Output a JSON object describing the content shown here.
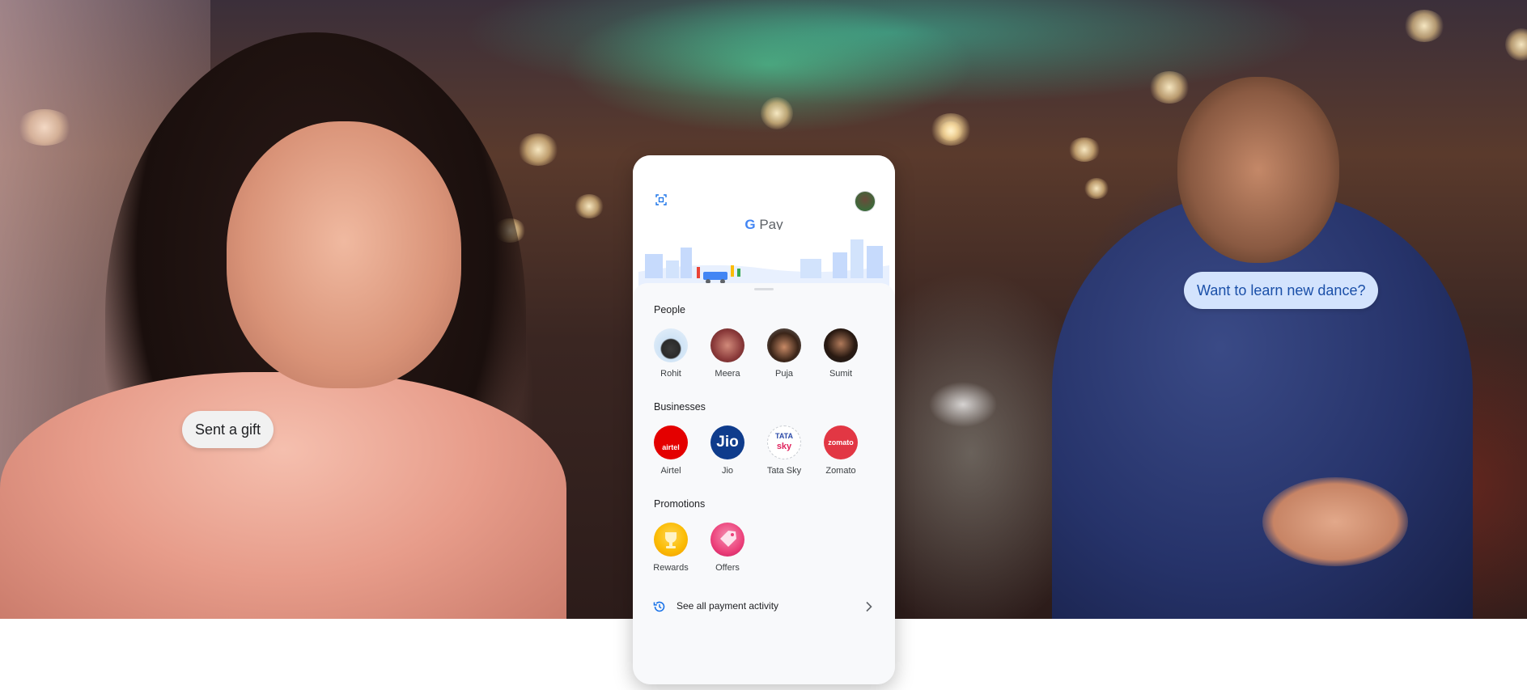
{
  "bubbles": {
    "left": "Sent a gift",
    "right": "Want to learn new dance?"
  },
  "app": {
    "logo_g": "G",
    "logo_text": "Pay"
  },
  "sections": {
    "people": {
      "title": "People",
      "items": [
        {
          "label": "Rohit"
        },
        {
          "label": "Meera"
        },
        {
          "label": "Puja"
        },
        {
          "label": "Sumit"
        }
      ]
    },
    "businesses": {
      "title": "Businesses",
      "items": [
        {
          "label": "Airtel",
          "logo_text": "airtel",
          "color": "#e40000"
        },
        {
          "label": "Jio",
          "logo_text": "Jio",
          "color": "#0f3c8c"
        },
        {
          "label": "Tata Sky",
          "logo_text_top": "TATA",
          "logo_text_bottom": "sky",
          "color": "#ffffff"
        },
        {
          "label": "Zomato",
          "logo_text": "zomato",
          "color": "#e23744"
        }
      ]
    },
    "promotions": {
      "title": "Promotions",
      "items": [
        {
          "label": "Rewards",
          "color": "#fbbc05"
        },
        {
          "label": "Offers",
          "color": "#f06292"
        }
      ]
    }
  },
  "activity": {
    "label": "See all payment activity"
  },
  "colors": {
    "accent": "#1a73e8",
    "bubble_right_bg": "#d3e3fd",
    "bubble_right_text": "#1a4fa8",
    "bubble_left_bg": "#f1f1f1"
  }
}
